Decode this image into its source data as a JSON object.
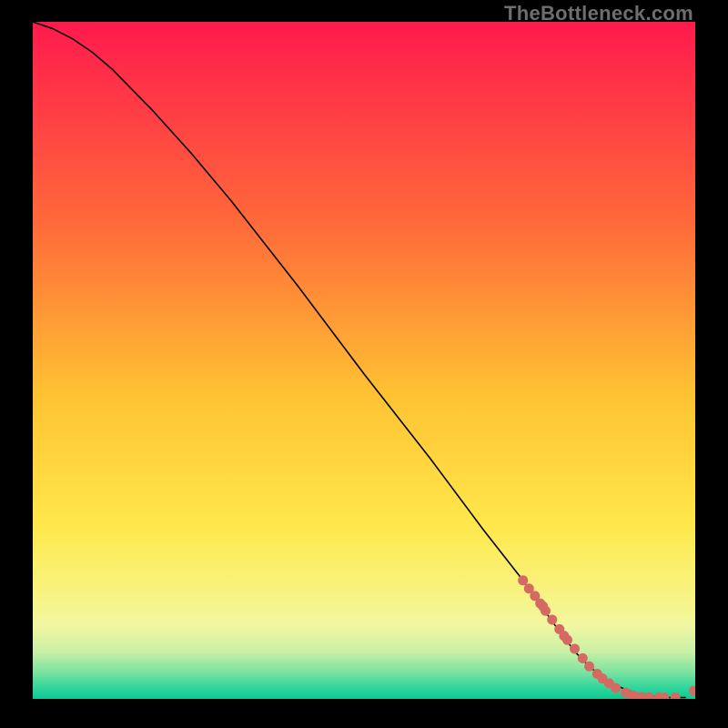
{
  "watermark": "TheBottleneck.com",
  "chart_data": {
    "type": "line",
    "title": "",
    "xlabel": "",
    "ylabel": "",
    "xlim": [
      0,
      100
    ],
    "ylim": [
      0,
      100
    ],
    "grid": false,
    "legend": false,
    "background_gradient": {
      "stops": [
        {
          "offset": 0.0,
          "color": "#ff1a4d"
        },
        {
          "offset": 0.3,
          "color": "#ff6a3a"
        },
        {
          "offset": 0.55,
          "color": "#ffc233"
        },
        {
          "offset": 0.74,
          "color": "#ffe74a"
        },
        {
          "offset": 0.83,
          "color": "#f9f279"
        },
        {
          "offset": 0.89,
          "color": "#f2f7a0"
        },
        {
          "offset": 0.93,
          "color": "#c9f0a5"
        },
        {
          "offset": 0.96,
          "color": "#7de3a0"
        },
        {
          "offset": 0.985,
          "color": "#2bd59b"
        },
        {
          "offset": 1.0,
          "color": "#0fc792"
        }
      ]
    },
    "series": [
      {
        "name": "curve",
        "type": "line",
        "color": "#000000",
        "stroke_width": 1.6,
        "x": [
          0,
          3,
          6,
          9,
          12,
          18,
          24,
          30,
          40,
          50,
          60,
          68,
          74,
          78,
          80,
          82,
          84,
          86,
          88,
          90,
          92,
          94,
          96,
          98,
          98.5
        ],
        "y": [
          100,
          99,
          97.5,
          95.5,
          93,
          87,
          80.5,
          73.5,
          61,
          48,
          35.5,
          25,
          17.5,
          12,
          9.3,
          6.8,
          4.8,
          3.2,
          2.0,
          1.2,
          0.6,
          0.3,
          0.2,
          0.2,
          0.2
        ]
      },
      {
        "name": "points",
        "type": "scatter",
        "color": "#d46a62",
        "radius": 5.5,
        "x": [
          74.0,
          74.9,
          75.8,
          76.6,
          77.0,
          77.4,
          78.4,
          79.5,
          80.2,
          80.7,
          81.8,
          83.0,
          84.0,
          85.2,
          86.0,
          87.0,
          88.0,
          89.5,
          90.5,
          91.3,
          92.0,
          93.0,
          94.5,
          95.3,
          97.0,
          99.8
        ],
        "y": [
          17.5,
          16.3,
          15.2,
          14.1,
          13.7,
          13.0,
          11.7,
          10.3,
          9.3,
          8.7,
          7.4,
          6.0,
          4.8,
          3.7,
          3.0,
          2.3,
          1.6,
          0.9,
          0.5,
          0.3,
          0.25,
          0.22,
          0.2,
          0.2,
          0.2,
          1.2
        ]
      }
    ]
  }
}
